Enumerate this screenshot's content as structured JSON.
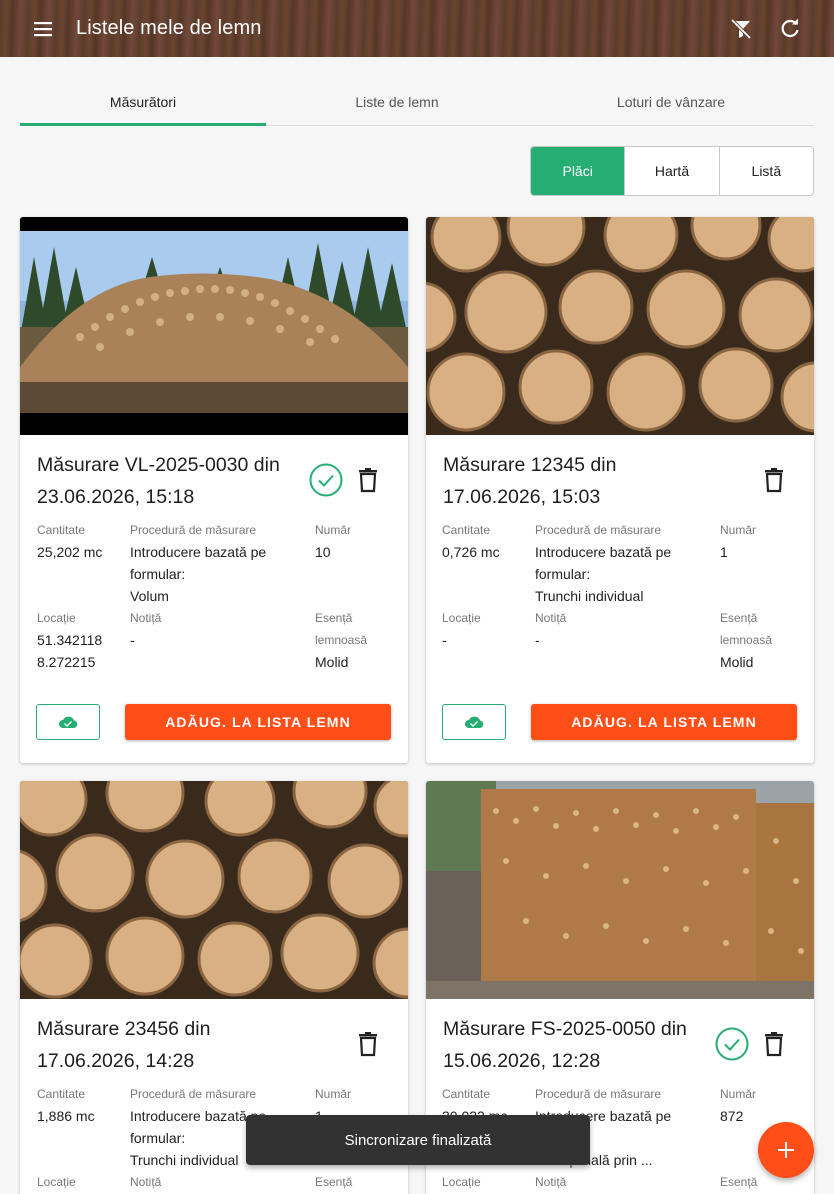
{
  "appbar": {
    "title": "Listele mele de lemn",
    "menu_icon": "menu-icon",
    "actions": [
      "filter-off-icon",
      "refresh-icon"
    ]
  },
  "tabs": [
    {
      "label": "Măsurători",
      "active": true
    },
    {
      "label": "Liste de lemn",
      "active": false
    },
    {
      "label": "Loturi de vânzare",
      "active": false
    }
  ],
  "view_toggle": [
    {
      "label": "Plăci",
      "active": true
    },
    {
      "label": "Hartă",
      "active": false
    },
    {
      "label": "Listă",
      "active": false
    }
  ],
  "labels": {
    "quantity": "Cantitate",
    "procedure": "Procedură de măsurare",
    "number": "Număr",
    "location": "Locație",
    "note": "Notiță",
    "species_line1": "Esență",
    "species_line2": "lemnoasă",
    "add_button": "ADĂUG. LA LISTA LEMN"
  },
  "cards": [
    {
      "title": "Măsurare VL-2025-0030 din 23.06.2026, 15:18",
      "synced": true,
      "quantity": "25,202 mc",
      "procedure_lines": [
        "Introducere bazată pe",
        "formular:",
        "Volum"
      ],
      "number": "10",
      "location_lines": [
        "51.342118",
        "8.272215"
      ],
      "note": "-",
      "species": "Molid"
    },
    {
      "title": "Măsurare 12345 din 17.06.2026, 15:03",
      "synced": false,
      "quantity": "0,726 mc",
      "procedure_lines": [
        "Introducere bazată pe",
        "formular:",
        "Trunchi individual"
      ],
      "number": "1",
      "location_lines": [
        "-",
        ""
      ],
      "note": "-",
      "species": "Molid"
    },
    {
      "title": "Măsurare 23456 din 17.06.2026, 14:28",
      "synced": false,
      "quantity": "1,886 mc",
      "procedure_lines": [
        "Introducere bazată pe",
        "formular:",
        "Trunchi individual"
      ],
      "number": "1"
    },
    {
      "title": "Măsurare FS-2025-0050 din 15.06.2026, 12:28",
      "synced": true,
      "quantity": "30,022 mc",
      "procedure_lines": [
        "Introducere bazată pe",
        "",
        "e secțională prin ..."
      ],
      "number": "872"
    }
  ],
  "snackbar": {
    "text": "Sincronizare finalizată"
  },
  "fab_icon": "plus-icon",
  "colors": {
    "accent": "#25ad72",
    "action": "#ff4e17",
    "appbar": "#5e3d2d"
  }
}
